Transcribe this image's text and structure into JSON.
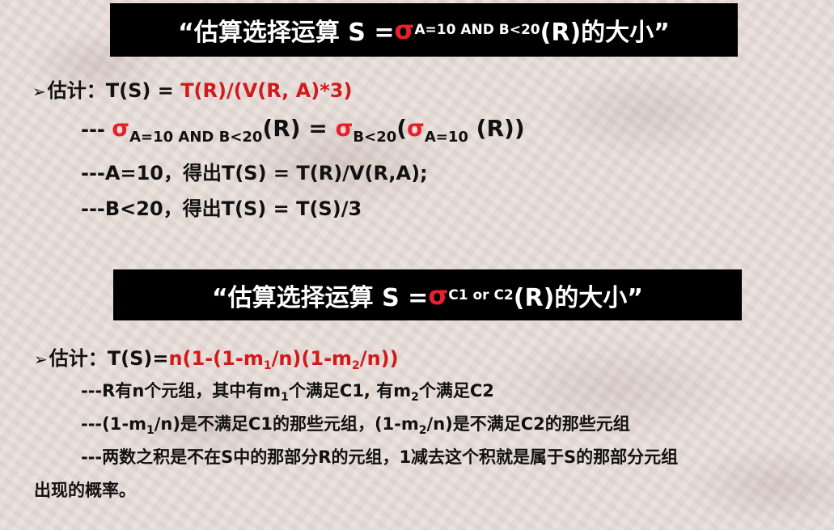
{
  "section1": {
    "banner": {
      "open_quote": "“估算选择运算 S = ",
      "sigma": "σ",
      "sigma_sub": "A=10 AND B<20",
      "rest": "(R)的大小”"
    },
    "estimate": {
      "bullet": "➢",
      "label": "估计：T(S) = ",
      "formula": "T(R)/(V(R, A)*3)"
    },
    "decomposition": {
      "prefix": "--- ",
      "sigma1": "σ",
      "sub1": "A=10 AND B<20",
      "mid": "(R) = ",
      "sigma2": "σ",
      "sub2": "B<20",
      "paren_open": "(",
      "sigma3": "σ",
      "sub3": "A=10",
      "tail": " (R))"
    },
    "step_a": "---A=10，得出T(S) = T(R)/V(R,A);",
    "step_b": "---B<20，得出T(S) = T(S)/3"
  },
  "section2": {
    "banner": {
      "open_quote": "“估算选择运算 S = ",
      "sigma": "σ",
      "sigma_sub": "C1 or C2",
      "rest": "(R)的大小”"
    },
    "estimate": {
      "bullet": "➢",
      "label": "估计：T(S)=",
      "f1": "n(1-(1-m",
      "f1_sub": "1",
      "f2": "/n)(1-m",
      "f2_sub": "2",
      "f3": "/n))"
    },
    "line1": {
      "a": "---R有n个元组，其中有m",
      "a_sub": "1",
      "b": "个满足C1, 有m",
      "b_sub": "2",
      "c": "个满足C2"
    },
    "line2": {
      "a": "---(1-m",
      "a_sub": "1",
      "b": "/n)是不满足C1的那些元组，(1-m",
      "b_sub": "2",
      "c": "/n)是不满足C2的那些元组"
    },
    "line3": "---两数之积是不在S中的那部分R的元组，1减去这个积就是属于S的那部分元组",
    "line4": "出现的概率。"
  }
}
